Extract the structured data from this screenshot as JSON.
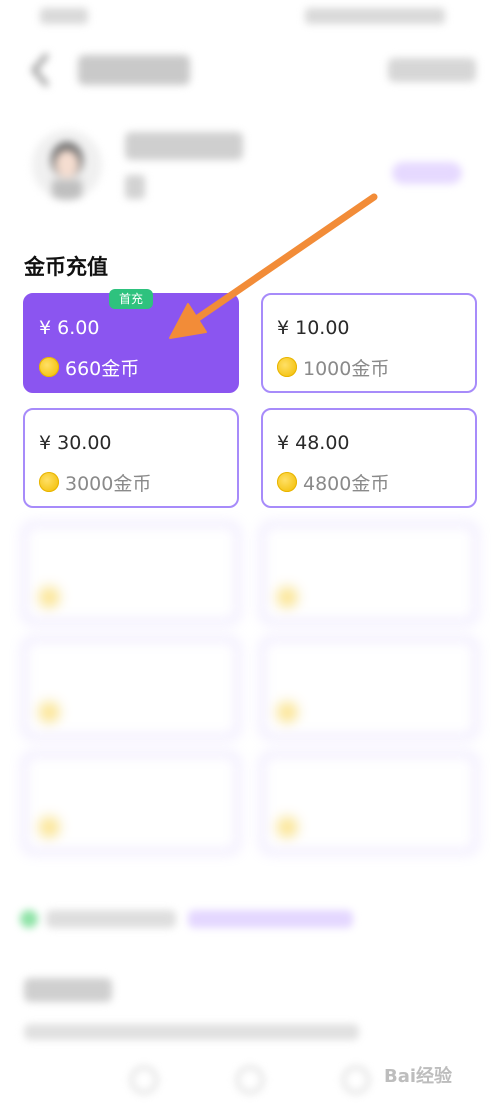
{
  "section_title": "金币充值",
  "cards": [
    {
      "price": "¥ 6.00",
      "coins": "660金币",
      "badge": "首充",
      "selected": true
    },
    {
      "price": "¥ 10.00",
      "coins": "1000金币",
      "selected": false
    },
    {
      "price": "¥ 30.00",
      "coins": "3000金币",
      "selected": false
    },
    {
      "price": "¥ 48.00",
      "coins": "4800金币",
      "selected": false
    }
  ],
  "watermark": "Bai经验",
  "colors": {
    "accent_purple": "#8b55f0",
    "card_border": "#a78bfa",
    "badge_green": "#2ec27e",
    "arrow_orange": "#f28c38"
  }
}
